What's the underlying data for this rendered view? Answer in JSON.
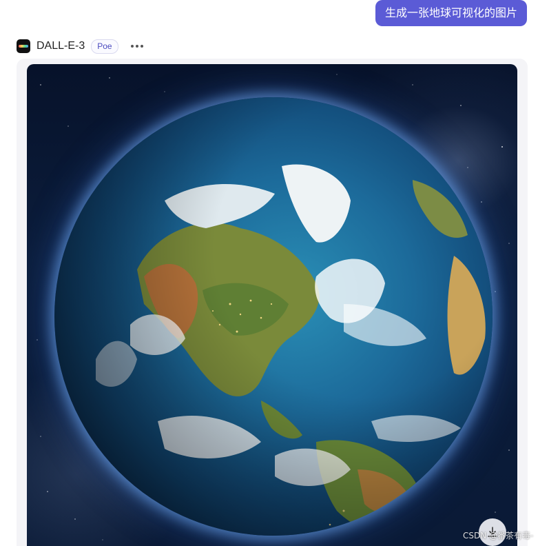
{
  "prompt": {
    "text": "生成一张地球可视化的图片"
  },
  "bot": {
    "name": "DALL-E-3",
    "badge": "Poe",
    "avatar_icon": "dalle-logo-icon",
    "more_icon": "more-horizontal-icon"
  },
  "image": {
    "subject": "earth-from-space",
    "download_icon": "download-icon"
  },
  "watermark": {
    "text": "CSDN @番茶有毒-"
  },
  "colors": {
    "prompt_bubble": "#5b5bd6",
    "badge_text": "#4b4bbf",
    "space": "#0b1d3c",
    "ocean": "#1c6a9a"
  }
}
